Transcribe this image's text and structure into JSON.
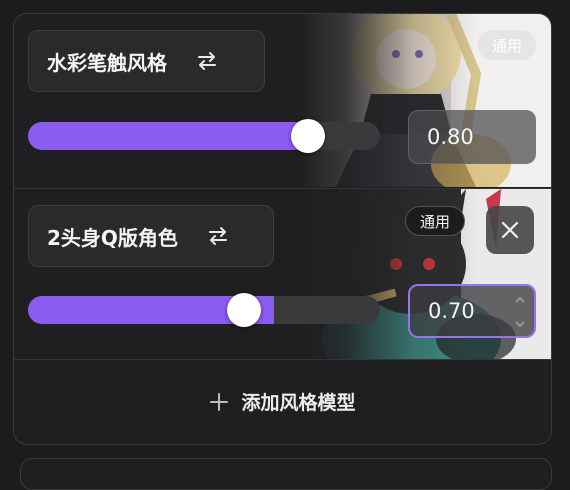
{
  "style_models": [
    {
      "name": "水彩笔触风格",
      "badge": "通用",
      "value": "0.80",
      "weight": 0.8,
      "swap_icon": "swap-arrows-icon",
      "preview_icon": "anime-girl-preview-image"
    },
    {
      "name": "2头身Q版角色",
      "badge": "通用",
      "value": "0.70",
      "weight": 0.7,
      "swap_icon": "swap-arrows-icon",
      "preview_icon": "chibi-cat-preview-image",
      "close_icon": "close-icon"
    }
  ],
  "add_button": {
    "icon": "plus-icon",
    "label": "添加风格模型"
  },
  "colors": {
    "accent": "#8a5cf0",
    "background": "#1c1c1e",
    "panel": "#1f1f21"
  }
}
